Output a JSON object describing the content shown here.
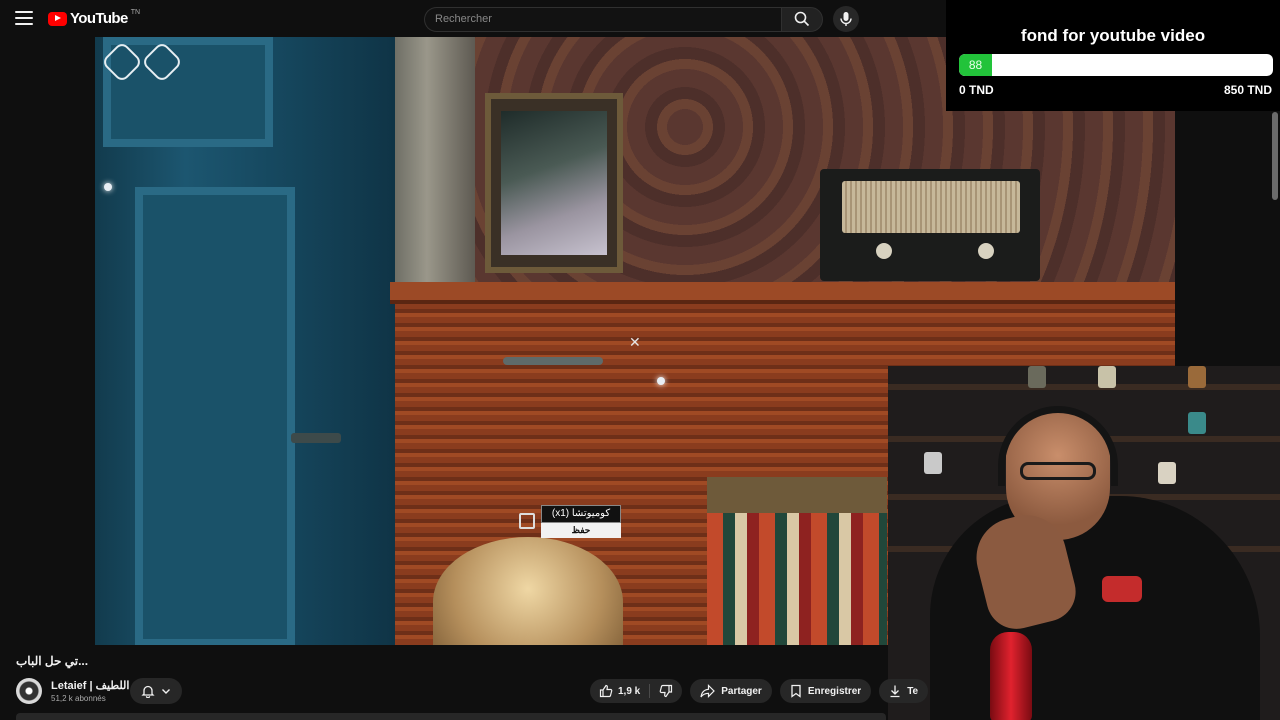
{
  "header": {
    "logo_text": "YouTube",
    "logo_region": "TN",
    "search_placeholder": "Rechercher",
    "icons": [
      "menu-icon",
      "search-icon",
      "microphone-icon"
    ]
  },
  "overlay": {
    "donation_title": "fond for youtube video",
    "progress_value": 88,
    "progress_max": 850,
    "progress_label": "88",
    "min_label": "0 TND",
    "max_label": "850 TND",
    "bar_color": "#22c33a"
  },
  "game": {
    "item_label": "كوميوتشا (x1)",
    "action_label": "حفظ"
  },
  "video": {
    "title": "...تي حل الباب"
  },
  "channel": {
    "name": "Letaief | اللطيف",
    "subscribers": "51,2 k abonnés"
  },
  "actions": {
    "likes": "1,9 k",
    "share": "Partager",
    "save": "Enregistrer",
    "download": "Te"
  },
  "colors": {
    "background": "#0f0f0f",
    "brand": "#ff0000",
    "pill": "#272727"
  }
}
